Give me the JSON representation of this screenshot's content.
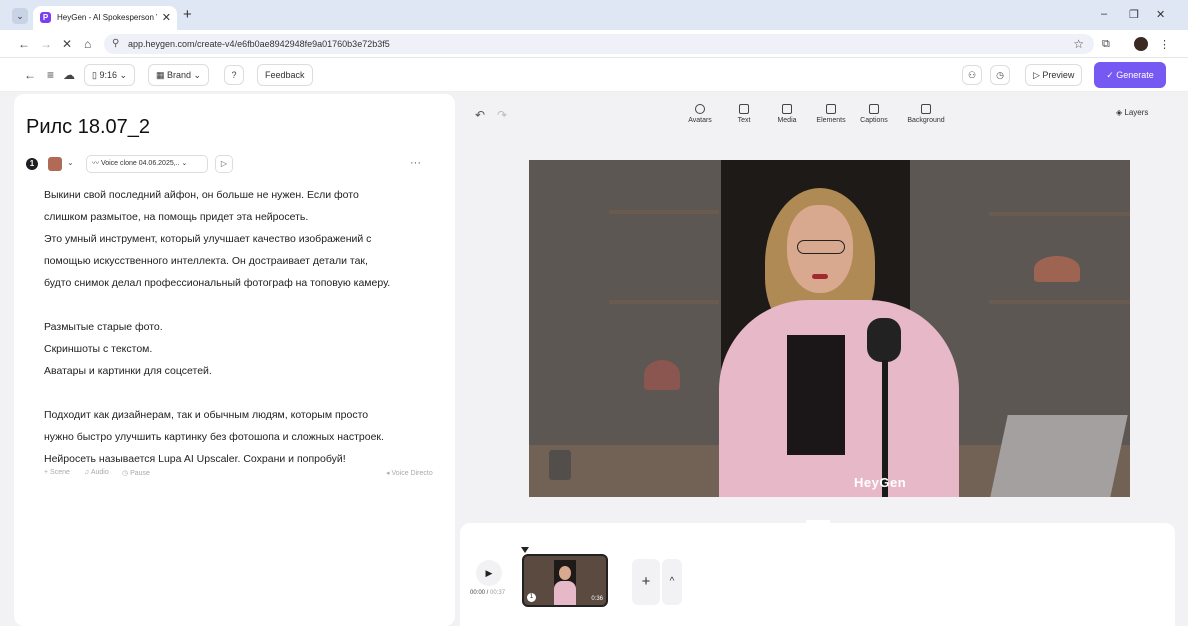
{
  "browser": {
    "tab_title": "HeyGen - AI Spokesperson Vide",
    "tab_favicon": "P",
    "url": "app.heygen.com/create-v4/e6fb0ae8942948fe9a01760b3e72b3f5",
    "new_tab": "+",
    "tab_close": "✕",
    "minimize": "–",
    "restore": "❐",
    "close": "✕"
  },
  "toolbar": {
    "ratio_label": "9:16",
    "brand_label": "Brand",
    "help_label": "?",
    "feedback_label": "Feedback",
    "preview_label": "Preview",
    "generate_label": "Generate",
    "generate_color": "#7559f2"
  },
  "script_panel": {
    "title": "Рилс 18.07_2",
    "scene_number": "1",
    "voice_label": "Voice clone 04.06.2025,..",
    "more": "···",
    "lines_block1": [
      "Выкини свой последний айфон, он больше не нужен. Если фото",
      "слишком размытое, на помощь придет эта нейросеть.",
      "Это умный инструмент, который улучшает качество изображений с",
      "помощью искусственного интеллекта. Он достраивает детали так,",
      "будто снимок делал профессиональный фотограф на топовую камеру."
    ],
    "lines_block2": [
      "Размытые старые фото.",
      "Скриншоты с текстом.",
      "Аватары и картинки для соцсетей."
    ],
    "lines_block3": [
      "Подходит как дизайнерам, так и обычным людям, которым просто",
      "нужно быстро улучшить картинку без фотошопа и сложных настроек.",
      "Нейросеть называется Lupa AI Upscaler. Сохрани и попробуй!"
    ],
    "actions": {
      "scene": "+ Scene",
      "audio": "Audio",
      "pause": "Pause",
      "voice_director": "Voice Directo"
    }
  },
  "canvas": {
    "tools": [
      "Avatars",
      "Text",
      "Media",
      "Elements",
      "Captions",
      "Background"
    ],
    "layers_label": "Layers",
    "watermark": "HeyGen"
  },
  "timeline": {
    "time_current": "00:00",
    "time_total": "00:37",
    "clip_index": "1",
    "clip_duration": "0:36",
    "add": "+",
    "expand": "^"
  }
}
